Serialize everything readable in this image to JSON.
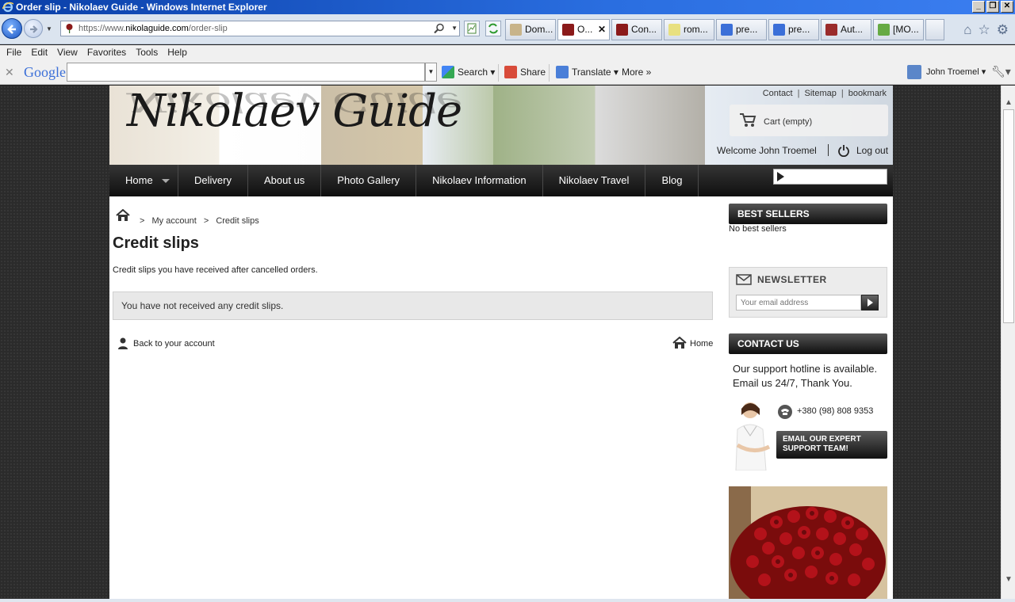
{
  "window": {
    "title": "Order slip - Nikolaev Guide - Windows Internet Explorer",
    "address_scheme": "https://www.",
    "address_domain": "nikolaguide.com",
    "address_path": "/order-slip"
  },
  "tabs": [
    {
      "label": "Dom...",
      "color": "#c8b48a"
    },
    {
      "label": "O...",
      "color": "#8b1a1a",
      "active": true
    },
    {
      "label": "Con...",
      "color": "#8b1a1a"
    },
    {
      "label": "rom...",
      "color": "#e8e080"
    },
    {
      "label": "pre...",
      "color": "#3b6fd8"
    },
    {
      "label": "pre...",
      "color": "#3b6fd8"
    },
    {
      "label": "Aut...",
      "color": "#9a2b2b"
    },
    {
      "label": "[MO...",
      "color": "#66aa44"
    }
  ],
  "menubar": {
    "file": "File",
    "edit": "Edit",
    "view": "View",
    "favorites": "Favorites",
    "tools": "Tools",
    "help": "Help"
  },
  "google_toolbar": {
    "logo": "Google",
    "search_label": "Search",
    "share_label": "Share",
    "translate_label": "Translate",
    "more_label": "More",
    "user": "John Troemel"
  },
  "site": {
    "logo": "Nikolaev Guide",
    "toplinks": [
      "Contact",
      "Sitemap",
      "bookmark"
    ],
    "cart": "Cart (empty)",
    "welcome": "Welcome John Troemel",
    "logout": "Log out",
    "nav": [
      "Home",
      "Delivery",
      "About us",
      "Photo Gallery",
      "Nikolaev Information",
      "Nikolaev Travel",
      "Blog"
    ]
  },
  "content": {
    "breadcrumb": [
      ">",
      "My account",
      ">",
      "Credit slips"
    ],
    "title": "Credit slips",
    "description": "Credit slips you have received after cancelled orders.",
    "alert": "You have not received any credit slips.",
    "back_link": "Back to your account",
    "home_link": "Home"
  },
  "sidebar": {
    "best_sellers_title": "BEST SELLERS",
    "best_sellers_empty": "No best sellers",
    "newsletter_title": "NEWSLETTER",
    "newsletter_placeholder": "Your email address",
    "contact_title": "CONTACT US",
    "support_text": "Our support hotline is available. Email us 24/7, Thank You.",
    "phone": "+380 (98) 808 9353",
    "email_button_line1": "EMAIL OUR EXPERT",
    "email_button_line2": "SUPPORT TEAM!"
  },
  "colors": {
    "titlebar": "#0a3fa8",
    "nav_dark": "#0f0f0f",
    "alert_bg": "#e8e8e8"
  }
}
